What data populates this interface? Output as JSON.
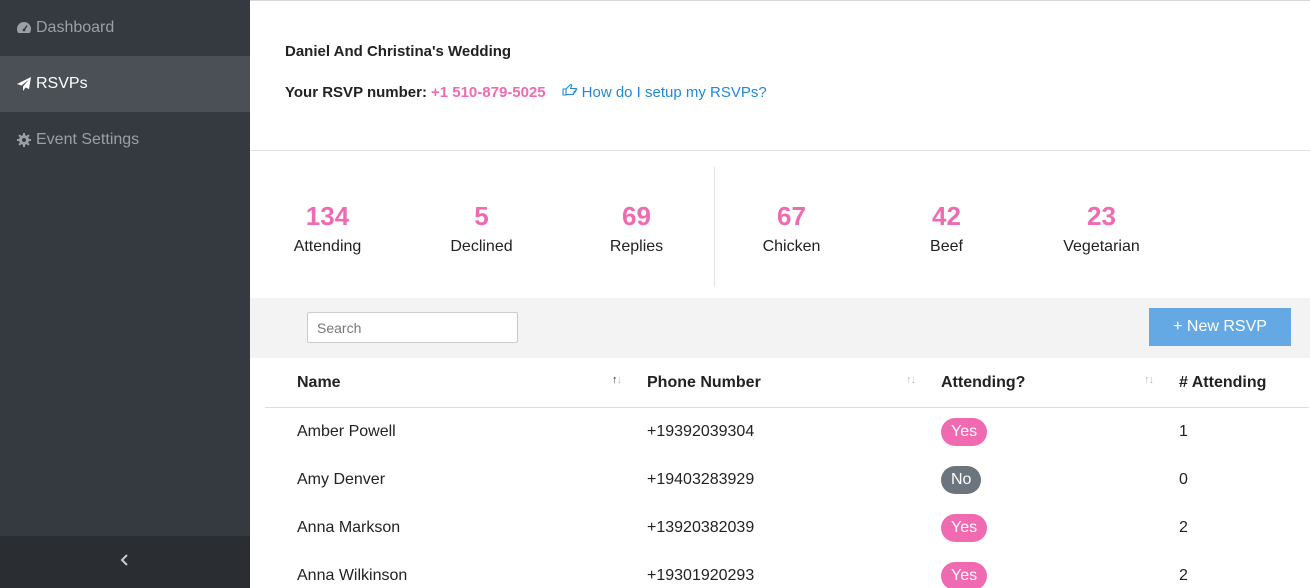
{
  "sidebar": {
    "items": [
      {
        "label": "Dashboard",
        "icon": "dashboard-icon",
        "active": false
      },
      {
        "label": "RSVPs",
        "icon": "paper-plane-icon",
        "active": true
      },
      {
        "label": "Event Settings",
        "icon": "gear-icon",
        "active": false
      }
    ],
    "collapse_icon": "chevron-left-icon"
  },
  "event": {
    "title": "Daniel And Christina's Wedding",
    "rsvp_label": "Your RSVP number:",
    "rsvp_phone": "+1 510-879-5025",
    "help_link": "How do I setup my RSVPs?",
    "help_icon": "hand-pointer-icon"
  },
  "stats": [
    {
      "value": "134",
      "label": "Attending"
    },
    {
      "value": "5",
      "label": "Declined"
    },
    {
      "value": "69",
      "label": "Replies"
    },
    {
      "value": "67",
      "label": "Chicken"
    },
    {
      "value": "42",
      "label": "Beef"
    },
    {
      "value": "23",
      "label": "Vegetarian"
    }
  ],
  "toolbar": {
    "search_placeholder": "Search",
    "new_button": "+ New RSVP"
  },
  "table": {
    "columns": [
      {
        "label": "Name",
        "sort": "ascending"
      },
      {
        "label": "Phone Number",
        "sort": "none"
      },
      {
        "label": "Attending?",
        "sort": "none"
      },
      {
        "label": "# Attending",
        "sort": "none"
      }
    ],
    "rows": [
      {
        "name": "Amber Powell",
        "phone": "+19392039304",
        "attending": "Yes",
        "count": "1"
      },
      {
        "name": "Amy Denver",
        "phone": "+19403283929",
        "attending": "No",
        "count": "0"
      },
      {
        "name": "Anna Markson",
        "phone": "+13920382039",
        "attending": "Yes",
        "count": "2"
      },
      {
        "name": "Anna Wilkinson",
        "phone": "+19301920293",
        "attending": "Yes",
        "count": "2"
      }
    ]
  },
  "colors": {
    "accent_pink": "#f06ab2",
    "link_blue": "#1f8ad8",
    "button_blue": "#64a9e3",
    "badge_no": "#6c757d",
    "sidebar_bg": "#353a40"
  }
}
